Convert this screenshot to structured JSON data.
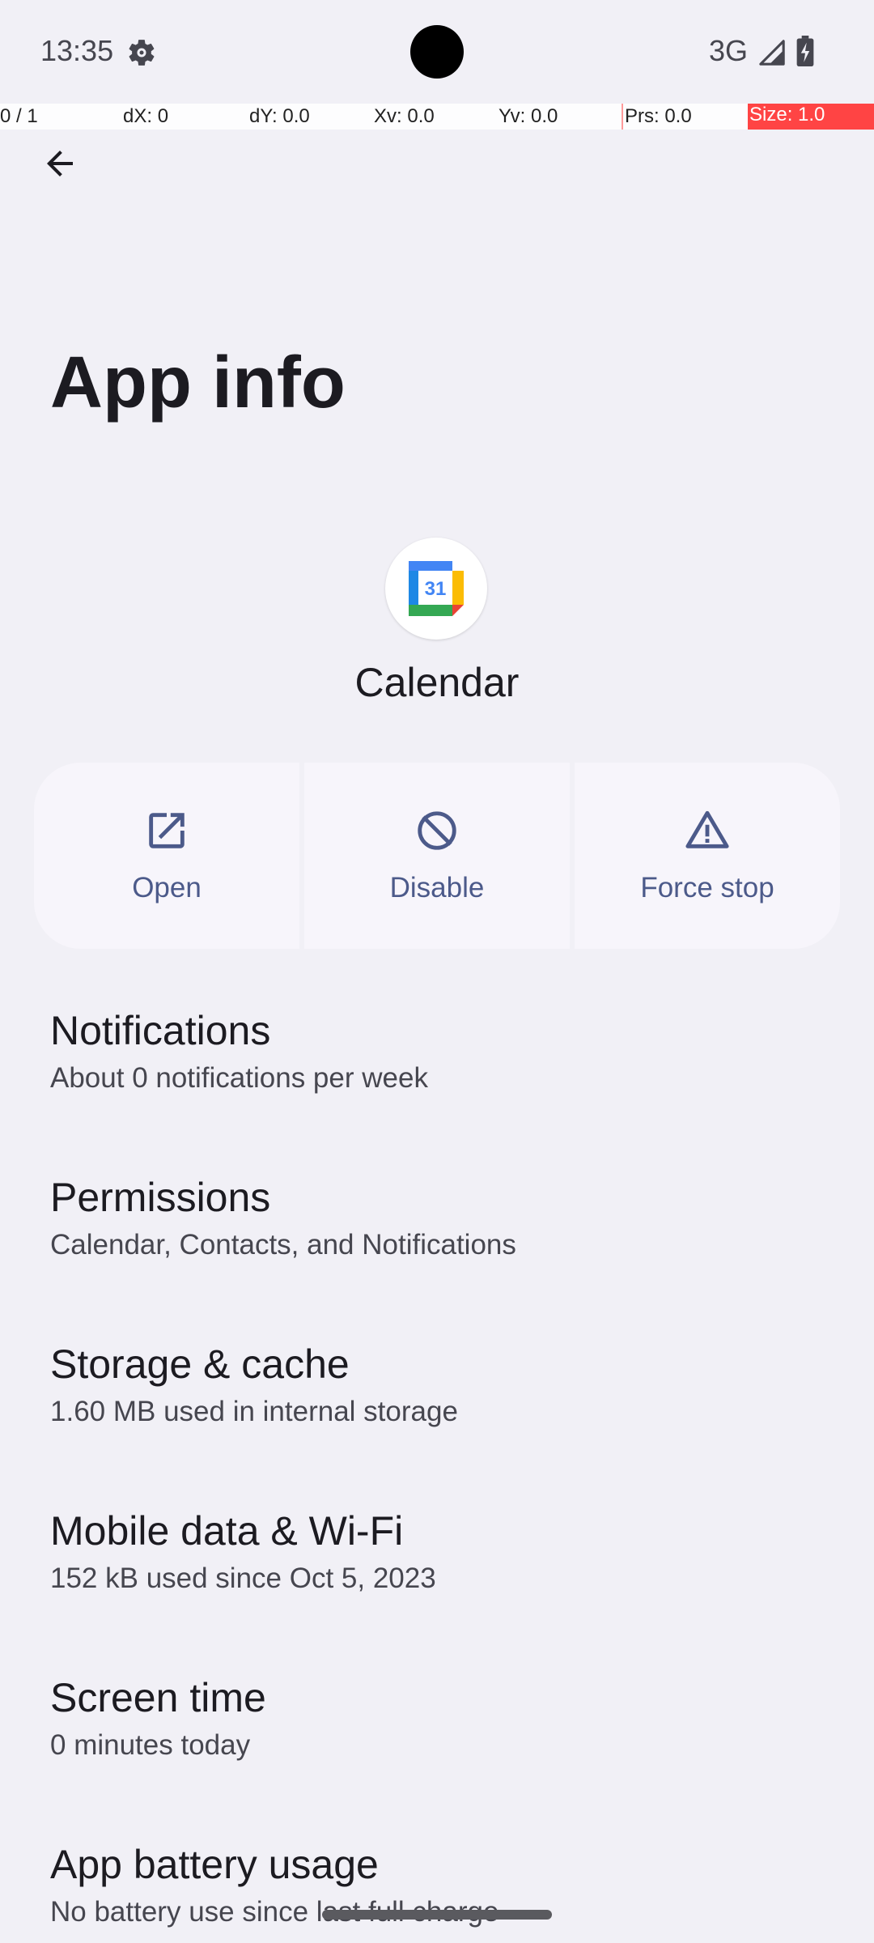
{
  "status_bar": {
    "time": "13:35",
    "network": "3G",
    "icons": [
      "settings-gear-icon",
      "cell-signal-icon",
      "battery-charging-icon"
    ]
  },
  "pointer_overlay": {
    "pointers": "0 / 1",
    "dx": "dX: 0",
    "dy": "dY: 0.0",
    "xv": "Xv: 0.0",
    "yv": "Yv: 0.0",
    "prs": "Prs: 0.0",
    "size": "Size: 1.0",
    "size_color": "#ff4444"
  },
  "header": {
    "back_icon": "arrow-back-icon",
    "title": "App info"
  },
  "app": {
    "name": "Calendar",
    "icon_day": "31"
  },
  "actions": [
    {
      "label": "Open",
      "icon": "open-external-icon"
    },
    {
      "label": "Disable",
      "icon": "disable-icon"
    },
    {
      "label": "Force stop",
      "icon": "warning-icon"
    }
  ],
  "settings": [
    {
      "title": "Notifications",
      "subtitle": "About 0 notifications per week"
    },
    {
      "title": "Permissions",
      "subtitle": "Calendar, Contacts, and Notifications"
    },
    {
      "title": "Storage & cache",
      "subtitle": "1.60 MB used in internal storage"
    },
    {
      "title": "Mobile data & Wi-Fi",
      "subtitle": "152 kB used since Oct 5, 2023"
    },
    {
      "title": "Screen time",
      "subtitle": "0 minutes today"
    },
    {
      "title": "App battery usage",
      "subtitle": "No battery use since last full charge"
    }
  ],
  "colors": {
    "background": "#f1f0f6",
    "accent": "#4c5a8a",
    "button_bg": "#f7f5fb"
  }
}
